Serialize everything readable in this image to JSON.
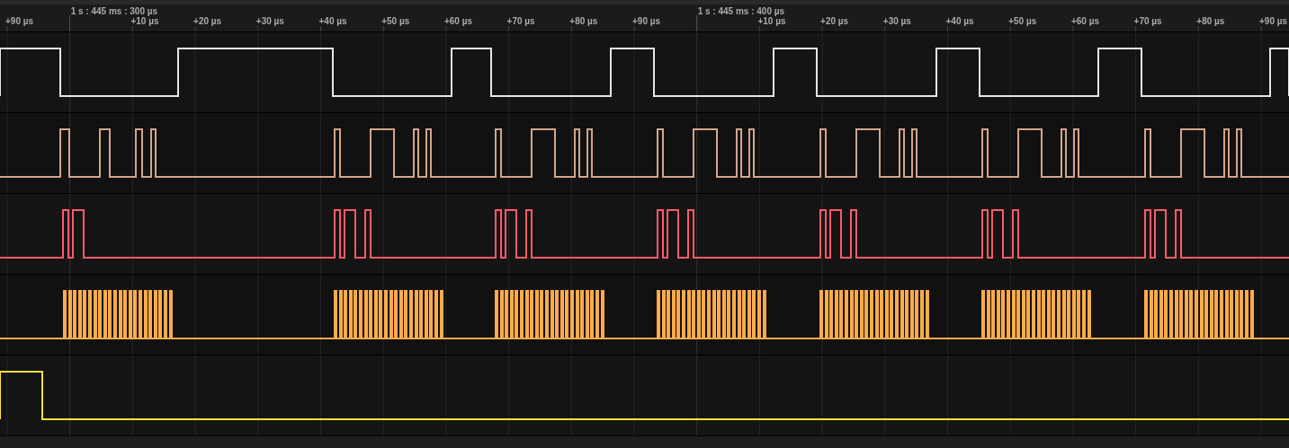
{
  "ruler": {
    "major_ticks": [
      {
        "label": "1 s : 445 ms : 300 µs"
      },
      {
        "label": "1 s : 445 ms : 400 µs"
      }
    ],
    "minor_ticks": [
      "+90 µs",
      "+10 µs",
      "+20 µs",
      "+30 µs",
      "+40 µs",
      "+50 µs",
      "+60 µs",
      "+70 µs",
      "+80 µs",
      "+90 µs",
      "+10 µs",
      "+20 µs",
      "+30 µs",
      "+40 µs",
      "+50 µs",
      "+60 µs",
      "+70 µs",
      "+80 µs",
      "+90 µs"
    ]
  },
  "channels": [
    {
      "color": "#e6e6e6"
    },
    {
      "color": "#d4a58a"
    },
    {
      "color": "#ff5a6a"
    },
    {
      "color": "#ffab4a"
    },
    {
      "color": "#ffe23e"
    }
  ]
}
